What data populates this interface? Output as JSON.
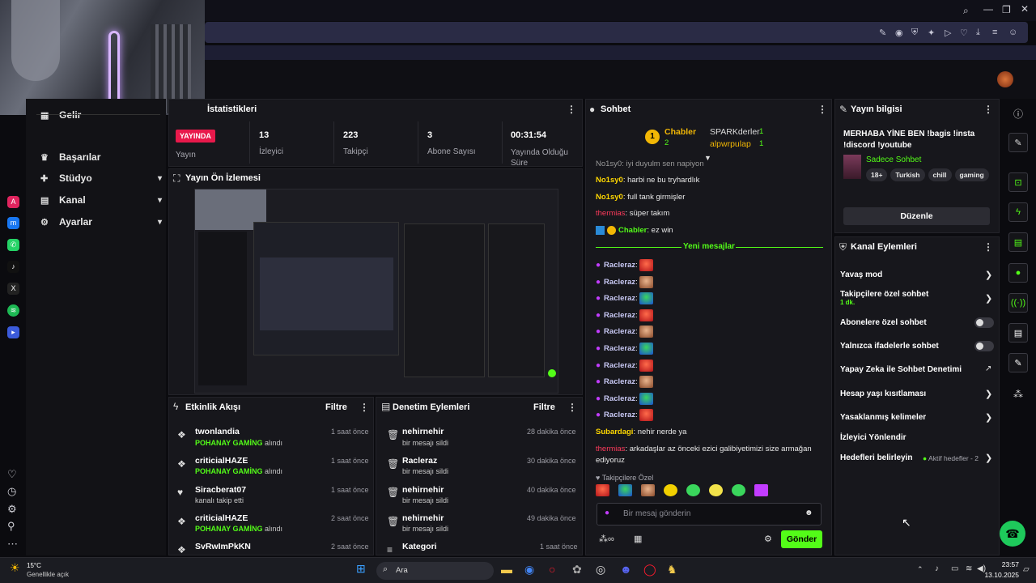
{
  "nav": {
    "partial_top": "Yayın",
    "items": [
      {
        "label": "Gelir",
        "icon": "dollar-icon",
        "expand": false
      },
      {
        "label": "Başarılar",
        "icon": "trophy-icon",
        "expand": false
      },
      {
        "label": "Stüdyo",
        "icon": "studio-icon",
        "expand": true
      },
      {
        "label": "Kanal",
        "icon": "channel-icon",
        "expand": true
      },
      {
        "label": "Ayarlar",
        "icon": "gear-icon",
        "expand": true
      }
    ]
  },
  "stats": {
    "title": "İstatistikleri",
    "badge": "YAYINDA",
    "items": [
      {
        "value": "",
        "label": "Yayın"
      },
      {
        "value": "13",
        "label": "İzleyici"
      },
      {
        "value": "223",
        "label": "Takipçi"
      },
      {
        "value": "3",
        "label": "Abone Sayısı"
      },
      {
        "value": "00:31:54",
        "label": "Yayında Olduğu Süre"
      }
    ]
  },
  "preview": {
    "title": "Yayın Ön İzlemesi"
  },
  "activity": {
    "title": "Etkinlik Akışı",
    "filter": "Filtre",
    "rows": [
      {
        "name": "twonlandia",
        "sub_strong": "POHANAY GAMİNG",
        "sub": " alındı",
        "time": "1 saat önce",
        "icon": "gift-icon"
      },
      {
        "name": "criticialHAZE",
        "sub_strong": "POHANAY GAMİNG",
        "sub": " alındı",
        "time": "1 saat önce",
        "icon": "gift-icon"
      },
      {
        "name": "Siracberat07",
        "sub_strong": "",
        "sub": "kanalı takip etti",
        "time": "1 saat önce",
        "icon": "heart-icon"
      },
      {
        "name": "criticialHAZE",
        "sub_strong": "POHANAY GAMİNG",
        "sub": " alındı",
        "time": "2 saat önce",
        "icon": "gift-icon"
      },
      {
        "name": "SvRwImPkKN",
        "sub_strong": "",
        "sub": "",
        "time": "2 saat önce",
        "icon": "gift-icon"
      }
    ]
  },
  "moderation": {
    "title": "Denetim Eylemleri",
    "filter": "Filtre",
    "rows": [
      {
        "name": "nehirnehir",
        "sub": "bir mesajı sildi",
        "time": "28 dakika önce"
      },
      {
        "name": "Racleraz",
        "sub": "bir mesajı sildi",
        "time": "30 dakika önce"
      },
      {
        "name": "nehirnehir",
        "sub": "bir mesajı sildi",
        "time": "40 dakika önce"
      },
      {
        "name": "nehirnehir",
        "sub": "bir mesajı sildi",
        "time": "49 dakika önce"
      },
      {
        "name": "Kategori",
        "sub": "",
        "time": "1 saat önce"
      }
    ]
  },
  "chat": {
    "title": "Sohbet",
    "top_gifters": [
      {
        "name": "Chabler",
        "count": "2",
        "rank": "1"
      },
      {
        "name": "SPARKderler",
        "count": "1"
      },
      {
        "name": "alpwrpulap",
        "count": "1"
      }
    ],
    "partial_line": "No1sy0: iyi duyulm sen napiyon",
    "messages": [
      {
        "user": "No1sy0",
        "text": "harbi ne bu tryhardlık",
        "cls": "u-no1"
      },
      {
        "user": "No1sy0",
        "text": "full tank girmişler",
        "cls": "u-no1"
      },
      {
        "user": "thermias",
        "text": "süper takım",
        "cls": "u-th"
      },
      {
        "user": "Chabler",
        "text": "ez win",
        "cls": "u-ch"
      }
    ],
    "new_messages_label": "Yeni mesajlar",
    "racleraz_user": "Racleraz",
    "racleraz_emotes": [
      "e-red",
      "e-face",
      "e-frog",
      "e-red",
      "e-face",
      "e-frog",
      "e-red",
      "e-face",
      "e-frog",
      "e-red"
    ],
    "after": [
      {
        "user": "Subardagi",
        "text": "nehir nerde ya",
        "cls": "u-sb"
      },
      {
        "user": "thermias",
        "text": "arkadaşlar az önceki ezici galibiyetimizi size armağan ediyoruz",
        "cls": "u-th"
      }
    ],
    "emote_section": "Takipçilere Özel",
    "input_placeholder": "Bir mesaj gönderin",
    "send_label": "Gönder"
  },
  "stream_info": {
    "title": "Yayın bilgisi",
    "text": "MERHABA YİNE BEN !bagis !insta !discord !youtube",
    "category": "Sadece Sohbet",
    "tags": [
      "18+",
      "Turkish",
      "chill",
      "gaming"
    ],
    "edit_label": "Düzenle"
  },
  "channel_actions": {
    "title": "Kanal Eylemleri",
    "slow_mode": "Yavaş mod",
    "followers_only": "Takipçilere özel sohbet",
    "followers_only_sub": "1 dk.",
    "subs_only": "Abonelere özel sohbet",
    "emotes_only": "Yalnızca ifadelerle sohbet",
    "ai_mod": "Yapay Zeka ile Sohbet Denetimi",
    "age_limit": "Hesap yaşı kısıtlaması",
    "banned_words": "Yasaklanmış kelimeler",
    "redirect": "İzleyici Yönlendir",
    "goals": "Hedefleri belirleyin",
    "goals_status": "Aktif hedefler - 2"
  },
  "taskbar": {
    "weather_temp": "15°C",
    "weather_desc": "Genellikle açık",
    "search": "Ara",
    "time": "23:57",
    "date": "13.10.2025"
  },
  "colors": {
    "accent": "#53fc18",
    "live": "#e8194b",
    "bg": "#0b0b0f",
    "panel": "#17171c"
  }
}
